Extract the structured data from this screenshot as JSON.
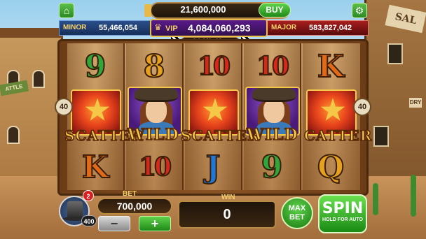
{
  "header": {
    "balance": "21,600,000",
    "buy_label": "BUY"
  },
  "jackpots": {
    "minor_label": "MINOR",
    "minor_value": "55,466,054",
    "vip_label": "VIP",
    "vip_value": "4,084,060,293",
    "major_label": "MAJOR",
    "major_value": "583,827,042",
    "timer": "0d:12h:10m"
  },
  "paylines": {
    "left": "40",
    "right": "40"
  },
  "reels": {
    "row1": [
      "9",
      "8",
      "10",
      "10",
      "K"
    ],
    "row2": [
      "SCATTER",
      "WILD",
      "SCATTER",
      "WILD",
      "SCATTER"
    ],
    "row3": [
      "K",
      "10",
      "J",
      "9",
      "Q"
    ]
  },
  "banner": {
    "b1": "SCATTER",
    "b2": "WILD",
    "b3": "SCATTER",
    "b4": "WILD",
    "b5": "CATTER"
  },
  "player": {
    "level": "400",
    "notifications": "2"
  },
  "bet": {
    "label": "BET",
    "value": "700,000",
    "minus": "−",
    "plus": "+"
  },
  "win": {
    "label": "WIN",
    "value": "0"
  },
  "buttons": {
    "max_bet_1": "MAX",
    "max_bet_2": "BET",
    "spin": "SPIN",
    "spin_sub": "HOLD FOR AUTO"
  },
  "background": {
    "right_sign": "SAL",
    "right_small_sign": "DRY",
    "left_sign": "ATTLE"
  },
  "icons": [
    "home-icon",
    "gear-icon",
    "coin-icon",
    "crown-icon",
    "sheriff-star-icon",
    "top-hat-icon"
  ]
}
